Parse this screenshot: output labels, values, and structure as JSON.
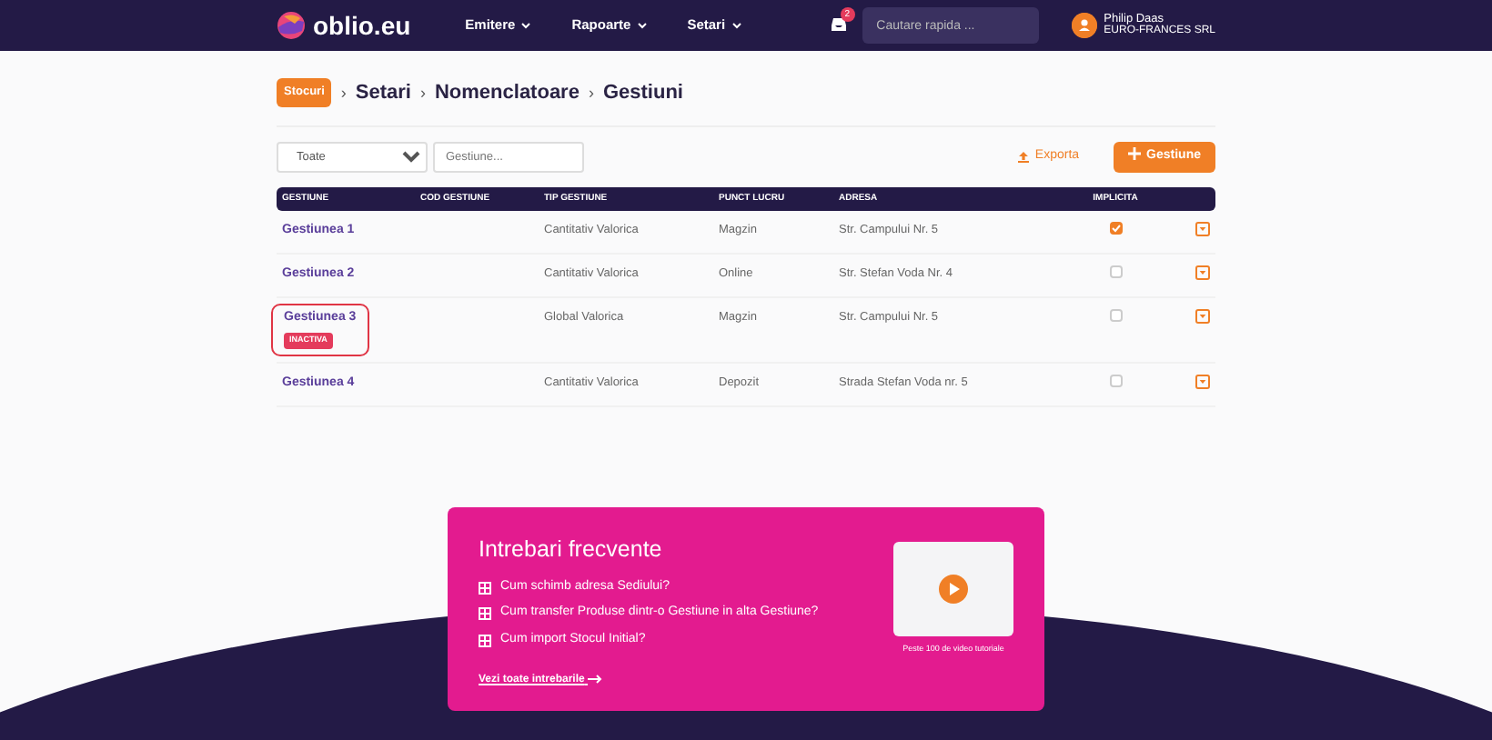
{
  "navbar": {
    "logo": "oblio.eu",
    "menu": [
      {
        "label": "Emitere"
      },
      {
        "label": "Rapoarte"
      },
      {
        "label": "Setari"
      }
    ],
    "notification_count": "2",
    "search": {
      "placeholder": "Cautare rapida ..."
    },
    "user": {
      "name": "Philip Daas",
      "company": "EURO-FRANCES SRL"
    }
  },
  "breadcrumb": {
    "module": "Stocuri",
    "separator": "›",
    "items": [
      "Setari",
      "Nomenclatoare",
      "Gestiuni"
    ]
  },
  "toolbar": {
    "filter": "Toate",
    "search": {
      "placeholder": "Gestiune..."
    },
    "export": "Exporta",
    "add": "Gestiune"
  },
  "table": {
    "columns": [
      "GESTIUNE",
      "COD GESTIUNE",
      "TIP GESTIUNE",
      "PUNCT LUCRU",
      "ADRESA",
      "IMPLICITA"
    ],
    "rows": [
      {
        "name": "Gestiunea 1",
        "type": "Cantitativ Valorica",
        "point": "Magzin",
        "address": "Str. Campului Nr. 5",
        "default": true,
        "inactive": false,
        "highlighted": false
      },
      {
        "name": "Gestiunea 2",
        "type": "Cantitativ Valorica",
        "point": "Online",
        "address": "Str. Stefan Voda Nr. 4",
        "default": false,
        "inactive": false,
        "highlighted": false
      },
      {
        "name": "Gestiunea 3",
        "type": "Global Valorica",
        "point": "Magzin",
        "address": "Str. Campului Nr. 5",
        "default": false,
        "inactive": true,
        "badge": "INACTIVA",
        "highlighted": true
      },
      {
        "name": "Gestiunea 4",
        "type": "Cantitativ Valorica",
        "point": "Depozit",
        "address": "Strada Stefan Voda nr. 5",
        "default": false,
        "inactive": false,
        "highlighted": false
      }
    ]
  },
  "faq": {
    "title": "Intrebari frecvente",
    "questions": [
      "Cum schimb adresa Sediului?",
      "Cum transfer Produse dintr-o Gestiune in alta Gestiune?",
      "Cum import Stocul Initial?"
    ],
    "all_link": "Vezi toate intrebarile",
    "video_caption": "Peste 100 de video tutoriale"
  }
}
